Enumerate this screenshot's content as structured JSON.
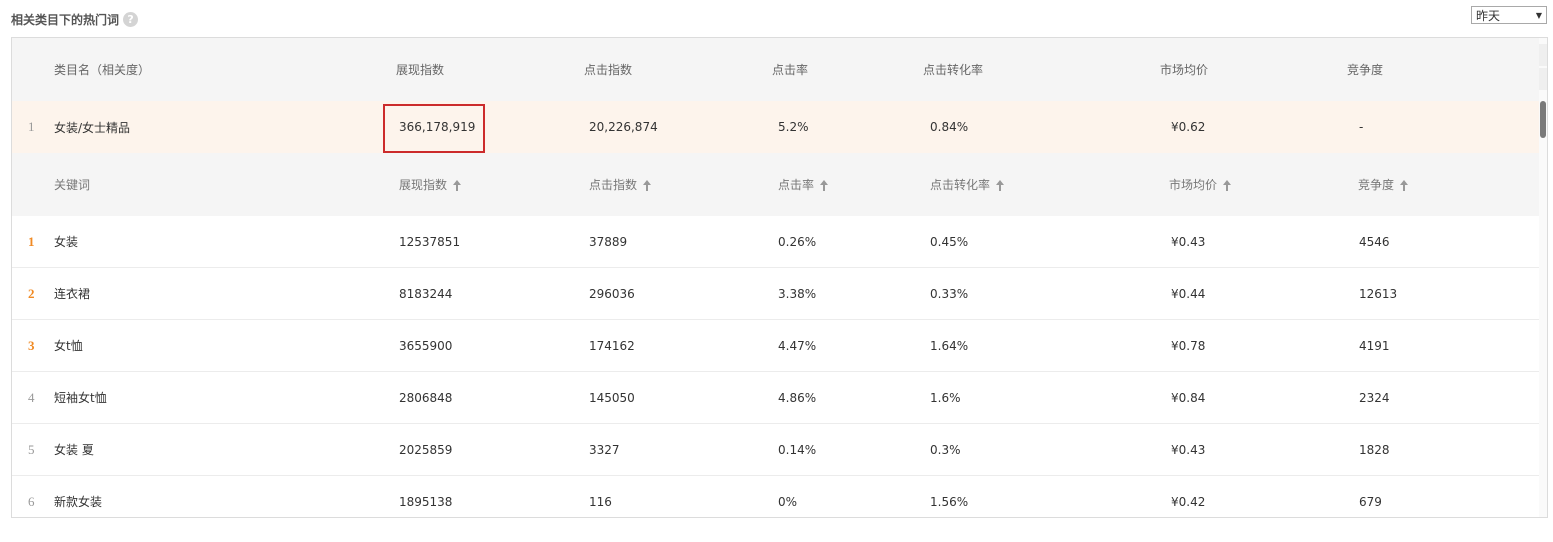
{
  "header": {
    "title": "相关类目下的热门词",
    "help_icon": "?",
    "date_select": {
      "value": "昨天",
      "chevron": "▼"
    }
  },
  "category_table": {
    "columns": [
      "类目名（相关度）",
      "展现指数",
      "点击指数",
      "点击率",
      "点击转化率",
      "市场均价",
      "竞争度"
    ],
    "row": {
      "index": "1",
      "name": "女装/女士精品",
      "impression": "366,178,919",
      "clicks": "20,226,874",
      "ctr": "5.2%",
      "conversion": "0.84%",
      "price": "¥0.62",
      "competition": "-"
    }
  },
  "keyword_table": {
    "columns": [
      "关键词",
      "展现指数",
      "点击指数",
      "点击率",
      "点击转化率",
      "市场均价",
      "竞争度"
    ],
    "rows": [
      {
        "index": "1",
        "keyword": "女装",
        "impression": "12537851",
        "clicks": "37889",
        "ctr": "0.26%",
        "conversion": "0.45%",
        "price": "¥0.43",
        "competition": "4546"
      },
      {
        "index": "2",
        "keyword": "连衣裙",
        "impression": "8183244",
        "clicks": "296036",
        "ctr": "3.38%",
        "conversion": "0.33%",
        "price": "¥0.44",
        "competition": "12613"
      },
      {
        "index": "3",
        "keyword": "女t恤",
        "impression": "3655900",
        "clicks": "174162",
        "ctr": "4.47%",
        "conversion": "1.64%",
        "price": "¥0.78",
        "competition": "4191"
      },
      {
        "index": "4",
        "keyword": "短袖女t恤",
        "impression": "2806848",
        "clicks": "145050",
        "ctr": "4.86%",
        "conversion": "1.6%",
        "price": "¥0.84",
        "competition": "2324"
      },
      {
        "index": "5",
        "keyword": "女装 夏",
        "impression": "2025859",
        "clicks": "3327",
        "ctr": "0.14%",
        "conversion": "0.3%",
        "price": "¥0.43",
        "competition": "1828"
      },
      {
        "index": "6",
        "keyword": "新款女装",
        "impression": "1895138",
        "clicks": "116",
        "ctr": "0%",
        "conversion": "1.56%",
        "price": "¥0.42",
        "competition": "679"
      }
    ]
  },
  "colors": {
    "highlight_box": "#cc2b2b",
    "top_rank": "#f08a24",
    "category_row_bg": "#fdf4ec"
  }
}
